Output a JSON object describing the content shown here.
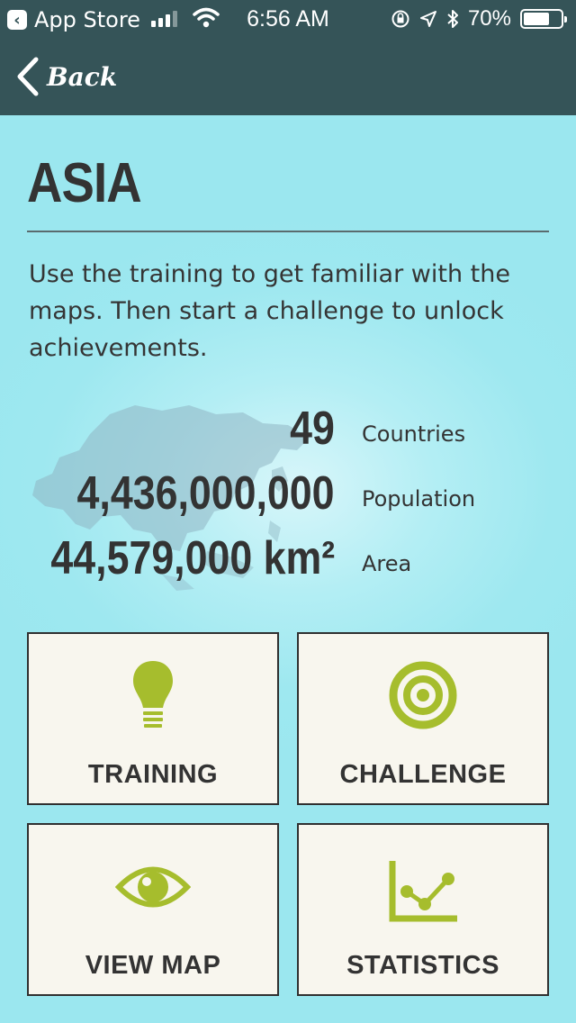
{
  "status_bar": {
    "back_app": "App Store",
    "time": "6:56 AM",
    "battery": "70%",
    "battery_level": 0.7,
    "signal_bars": 4,
    "signal_active": 3
  },
  "nav": {
    "back_label": "Back"
  },
  "region": {
    "title": "ASIA",
    "description": "Use the training to get familiar with the maps. Then start a challenge to unlock achievements."
  },
  "stats": [
    {
      "value": "49",
      "label": "Countries"
    },
    {
      "value": "4,436,000,000",
      "label": "Population"
    },
    {
      "value": "44,579,000 km²",
      "label": "Area"
    }
  ],
  "tiles": [
    {
      "label": "TRAINING",
      "icon": "lightbulb-icon"
    },
    {
      "label": "CHALLENGE",
      "icon": "target-icon"
    },
    {
      "label": "VIEW MAP",
      "icon": "eye-icon"
    },
    {
      "label": "STATISTICS",
      "icon": "line-chart-icon"
    }
  ],
  "colors": {
    "topbar": "#355458",
    "background": "#9ee8f0",
    "icon_green": "#a6bd2d",
    "tile_bg": "#f8f6ee"
  }
}
